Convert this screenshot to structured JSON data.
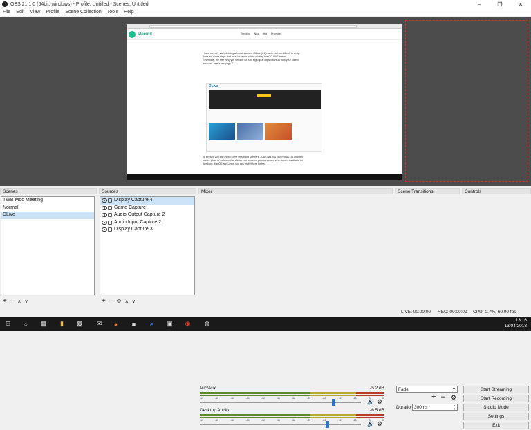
{
  "window": {
    "title": "OBS 21.1.0 (64bit, windows) - Profile: Untitled - Scenes: Untitled"
  },
  "menu": [
    "File",
    "Edit",
    "View",
    "Profile",
    "Scene Collection",
    "Tools",
    "Help"
  ],
  "preview": {
    "steemit_brand": "steemit",
    "steemit_nav": [
      "Trending",
      "New",
      "Hot",
      "Promoted"
    ],
    "article_lines": [
      "I have recently started doing a few streams on DLive (link), while not too difficult to setup",
      "there are some steps that must be taken before clicking the GO LIVE button.",
      "",
      "Essentially, the first thing you need to do is to sign up at https://dlive.io/ with your steem",
      "account - here's our page  S",
      "",
      "To stream, you then need some streaming software - OBS has you covered as it is an open",
      "source piece of software that allows you to record your screens and to stream. Available for",
      "Windows, MacOS and Linux, you can grab it  here for free."
    ],
    "dlive_label": "DLive"
  },
  "scenes": {
    "header": "Scenes",
    "items": [
      "TWB Mod Meeting",
      "Normal",
      "DLive"
    ],
    "selected_index": 2
  },
  "sources": {
    "header": "Sources",
    "items": [
      "Display Capture 4",
      "Game Capture",
      "Audio Output Capture 2",
      "Audio Input Capture 2",
      "Display Capture 3"
    ],
    "selected_index": 0
  },
  "mixer": {
    "header": "Mixer",
    "tracks": [
      {
        "name": "Mic/Aux",
        "db": "-5.2 dB",
        "volume_fraction": 0.83
      },
      {
        "name": "Desktop Audio",
        "db": "-6.5 dB",
        "volume_fraction": 0.79
      }
    ],
    "ticks": [
      "-60",
      "-55",
      "-50",
      "-45",
      "-40",
      "-35",
      "-30",
      "-25",
      "-20",
      "-15",
      "-10",
      "-5",
      "0"
    ]
  },
  "transitions": {
    "header": "Scene Transitions",
    "selected": "Fade",
    "duration_label": "Duration",
    "duration_value": "300ms"
  },
  "controls": {
    "header": "Controls",
    "buttons": [
      "Start Streaming",
      "Start Recording",
      "Studio Mode",
      "Settings",
      "Exit"
    ]
  },
  "status": {
    "live": "LIVE: 00:00:00",
    "rec": "REC: 00:00:00",
    "cpu": "CPU: 0.7%, 60.00 fps"
  },
  "taskbar": {
    "time": "13:16",
    "date": "13/04/2018"
  },
  "icons": [
    "obs-icon",
    "windows-start-icon",
    "search-icon",
    "task-view-icon",
    "file-explorer-icon",
    "store-icon",
    "mail-icon",
    "firefox-icon",
    "edge-icon",
    "chrome-icon"
  ]
}
